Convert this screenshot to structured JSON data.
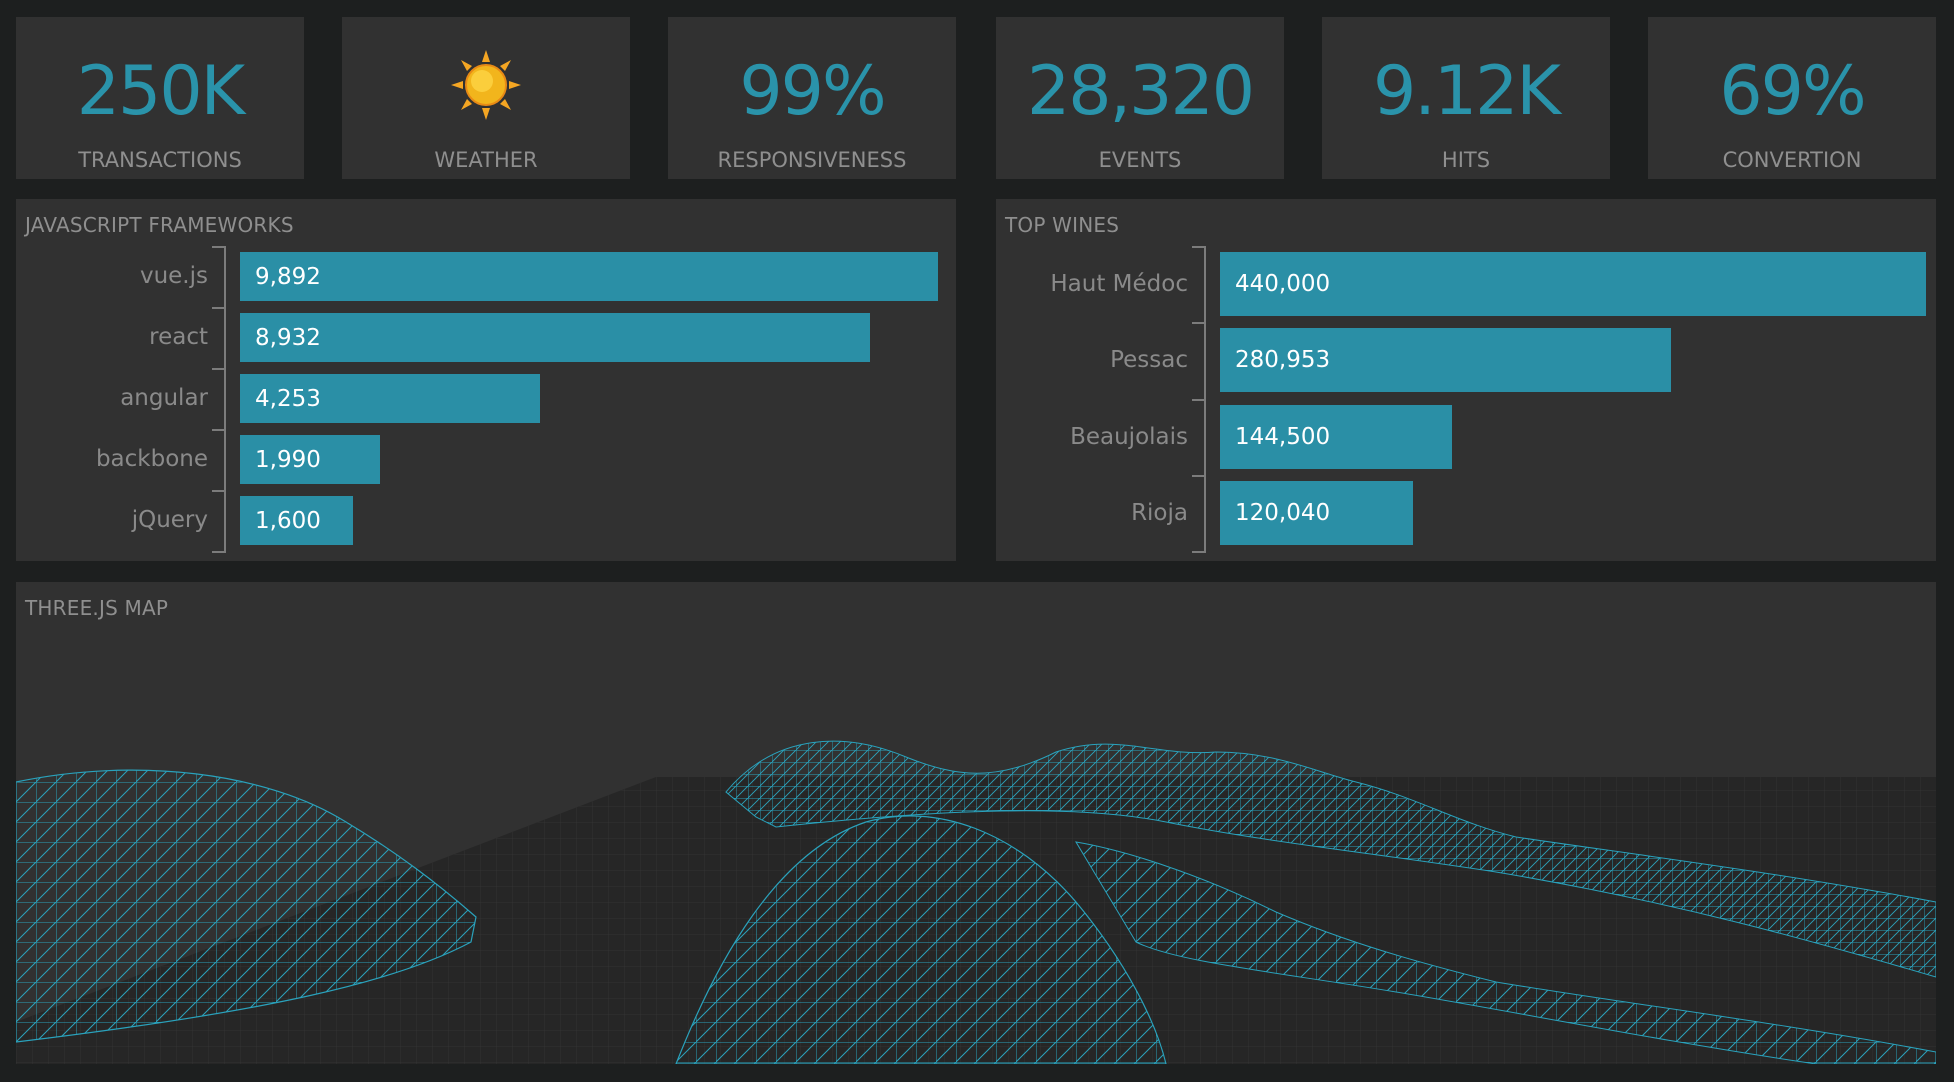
{
  "kpis": [
    {
      "value": "250K",
      "label": "TRANSACTIONS"
    },
    {
      "icon": "sun-icon",
      "label": "WEATHER"
    },
    {
      "value": "99%",
      "label": "RESPONSIVENESS"
    },
    {
      "value": "28,320",
      "label": "EVENTS"
    },
    {
      "value": "9.12K",
      "label": "HITS"
    },
    {
      "value": "69%",
      "label": "CONVERTION"
    }
  ],
  "frameworks": {
    "title": "JAVASCRIPT FRAMEWORKS",
    "chart_data": {
      "type": "bar",
      "categories": [
        "vue.js",
        "react",
        "angular",
        "backbone",
        "jQuery"
      ],
      "values": [
        9892,
        8932,
        4253,
        1990,
        1600
      ],
      "labels": [
        "9,892",
        "8,932",
        "4,253",
        "1,990",
        "1,600"
      ]
    }
  },
  "wines": {
    "title": "TOP WINES",
    "chart_data": {
      "type": "bar",
      "categories": [
        "Haut Médoc",
        "Pessac",
        "Beaujolais",
        "Rioja"
      ],
      "values": [
        440000,
        280953,
        144500,
        120040
      ],
      "labels": [
        "440,000",
        "280,953",
        "144,500",
        "120,040"
      ]
    }
  },
  "map": {
    "title": "THREE.JS MAP"
  },
  "colors": {
    "accent": "#2a93aa",
    "panel": "#313131",
    "background": "#1d1f1f"
  }
}
